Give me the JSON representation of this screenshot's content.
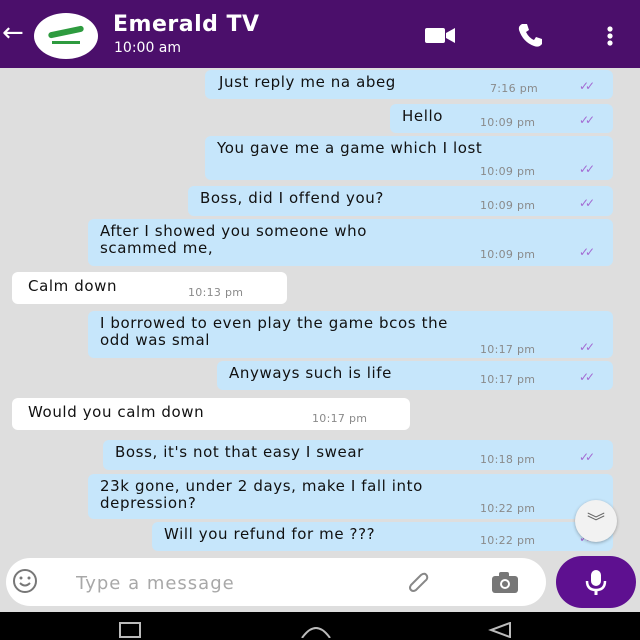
{
  "header": {
    "contact_name": "Emerald TV",
    "status": "10:00 am",
    "back_icon": "arrow-left-icon",
    "actions": [
      "video-call-icon",
      "phone-icon",
      "more-vertical-icon"
    ]
  },
  "messages": [
    {
      "dir": "out",
      "text": "Just reply me na abeg",
      "time": "7:16 pm",
      "status": "read"
    },
    {
      "dir": "out",
      "text": "Hello",
      "time": "10:09 pm",
      "status": "read"
    },
    {
      "dir": "out",
      "text": "You gave me a game which I lost",
      "time": "10:09 pm",
      "status": "read"
    },
    {
      "dir": "out",
      "text": "Boss, did I offend you?",
      "time": "10:09 pm",
      "status": "read"
    },
    {
      "dir": "out",
      "text": "After I showed you someone who\nscammed me,",
      "time": "10:09 pm",
      "status": "read"
    },
    {
      "dir": "in",
      "text": "Calm down",
      "time": "10:13 pm"
    },
    {
      "dir": "out",
      "text": "I borrowed to even play the game bcos the\nodd was smal",
      "time": "10:17 pm",
      "status": "read"
    },
    {
      "dir": "out",
      "text": "Anyways such is life",
      "time": "10:17 pm",
      "status": "read"
    },
    {
      "dir": "in",
      "text": "Would you calm down",
      "time": "10:17 pm"
    },
    {
      "dir": "out",
      "text": "Boss, it's not that easy I swear",
      "time": "10:18 pm",
      "status": "read"
    },
    {
      "dir": "out",
      "text": "23k gone, under 2 days, make I fall into\ndepression?",
      "time": "10:22 pm",
      "status": "read"
    },
    {
      "dir": "out",
      "text": "Will you refund for me ???",
      "time": "10:22 pm",
      "status": "read"
    }
  ],
  "composer": {
    "placeholder": "Type a message"
  },
  "colors": {
    "header": "#4b0f6b",
    "outgoing_bubble": "#c6e6fb",
    "incoming_bubble": "#ffffff",
    "read_ticks": "#a36bd3",
    "mic_button": "#5e1090",
    "chat_background": "#dedede"
  },
  "ticks_glyph": "✓✓",
  "scroll_down_glyph": "︾"
}
